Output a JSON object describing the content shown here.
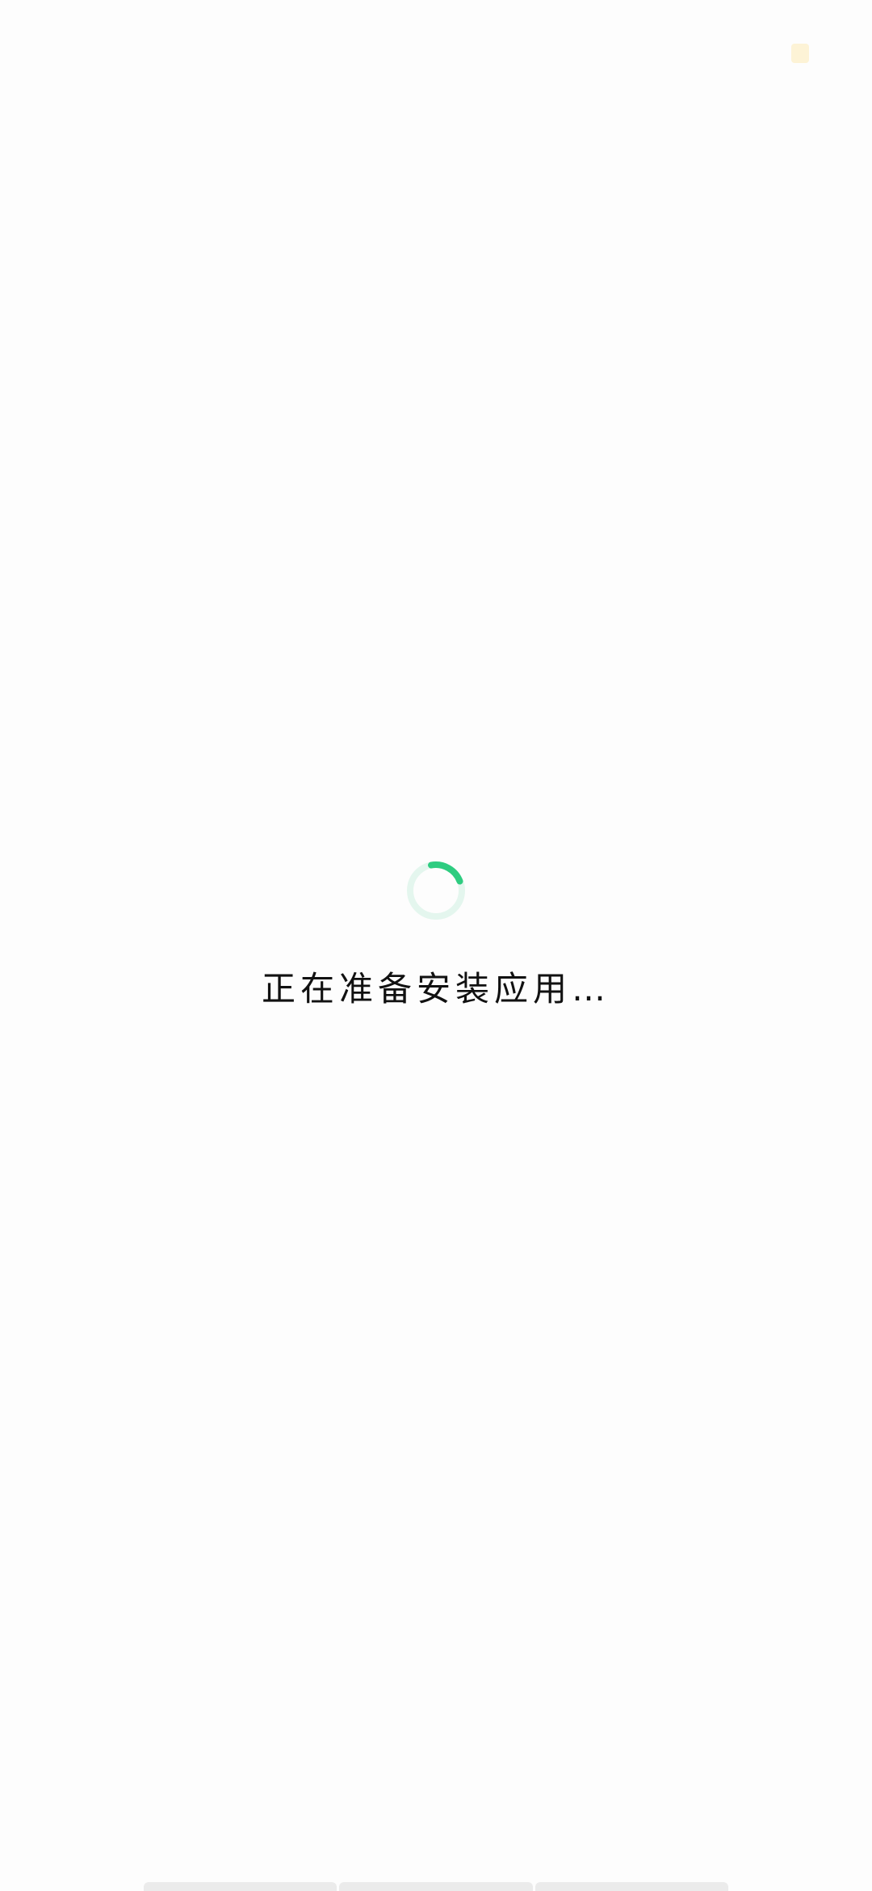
{
  "status": {
    "indicator_icon": "app-badge-icon",
    "indicator_color": "#fdf1cf"
  },
  "loading": {
    "spinner_icon": "loading-spinner-icon",
    "accent_color": "#2ecc80",
    "track_color": "#e4f6ee",
    "message": "正在准备安装应用…"
  },
  "bottom_bar": {
    "segments": 3,
    "color": "#ebebeb"
  }
}
